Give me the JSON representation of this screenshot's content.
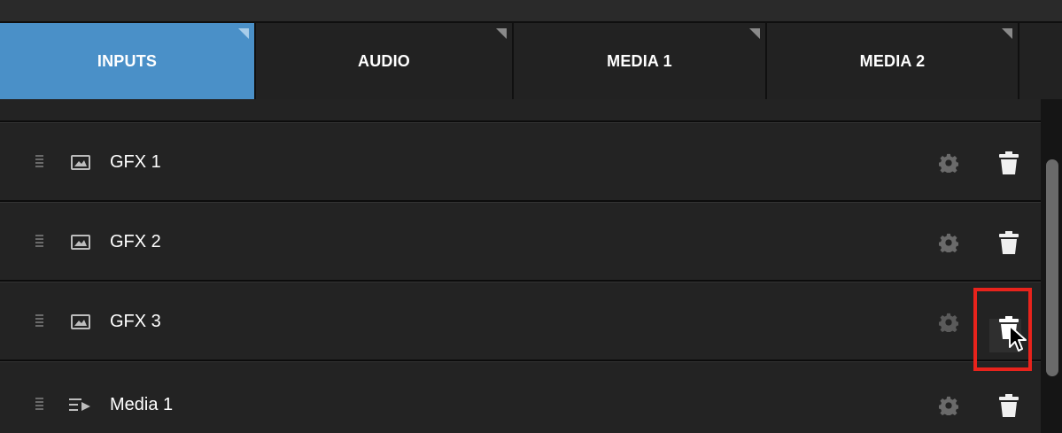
{
  "tabs": [
    {
      "label": "INPUTS",
      "active": true
    },
    {
      "label": "AUDIO",
      "active": false
    },
    {
      "label": "MEDIA 1",
      "active": false
    },
    {
      "label": "MEDIA 2",
      "active": false
    }
  ],
  "rows": [
    {
      "label": "GFX 1",
      "icon": "image-icon"
    },
    {
      "label": "GFX 2",
      "icon": "image-icon"
    },
    {
      "label": "GFX 3",
      "icon": "image-icon"
    },
    {
      "label": "Media 1",
      "icon": "media-playlist-icon"
    }
  ],
  "colors": {
    "active_tab": "#4a90c8",
    "highlight": "#e8231c",
    "background": "#1e1e1e"
  }
}
